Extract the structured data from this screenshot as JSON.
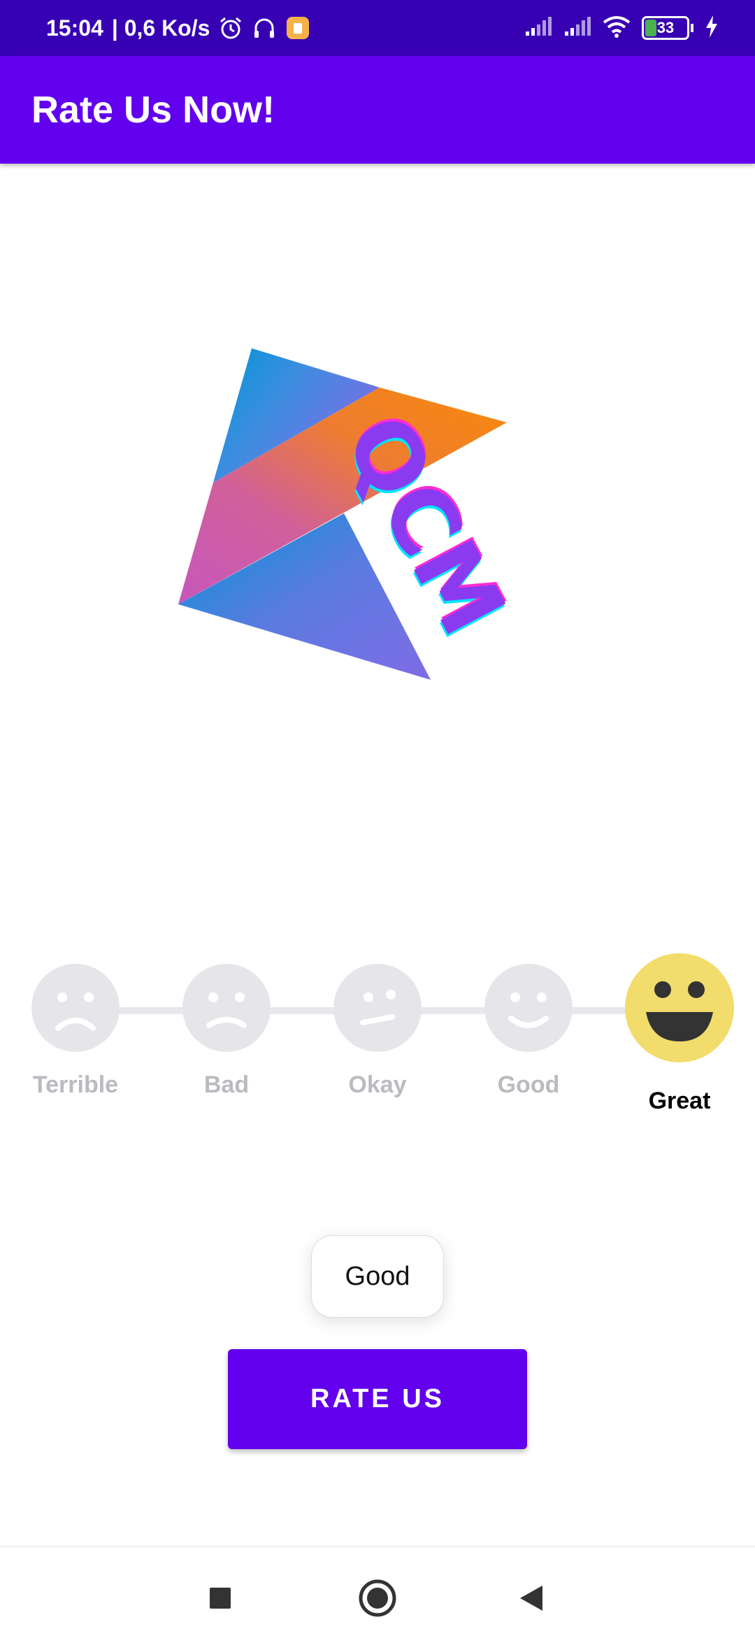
{
  "status_bar": {
    "time": "15:04",
    "speed": "| 0,6 Ko/s",
    "battery": "33",
    "icons": [
      "alarm-icon",
      "headset-icon",
      "notification-app-icon",
      "signal-icon",
      "signal-icon",
      "wifi-icon",
      "battery-icon",
      "charging-icon"
    ]
  },
  "app_bar": {
    "title": "Rate Us Now!"
  },
  "logo": {
    "text": "QCM"
  },
  "rating": {
    "options": [
      "Terrible",
      "Bad",
      "Okay",
      "Good",
      "Great"
    ],
    "selected": "Great",
    "colors": {
      "inactive_face": "#e6e6ea",
      "active_face": "#F2DC6B"
    }
  },
  "toast": {
    "text": "Good"
  },
  "button": {
    "label": "RATE US"
  },
  "nav": {
    "icons": [
      "recents-square-icon",
      "home-circle-icon",
      "back-triangle-icon"
    ]
  },
  "colors": {
    "primary": "#6200EE",
    "primary_dark": "#3700B3"
  }
}
